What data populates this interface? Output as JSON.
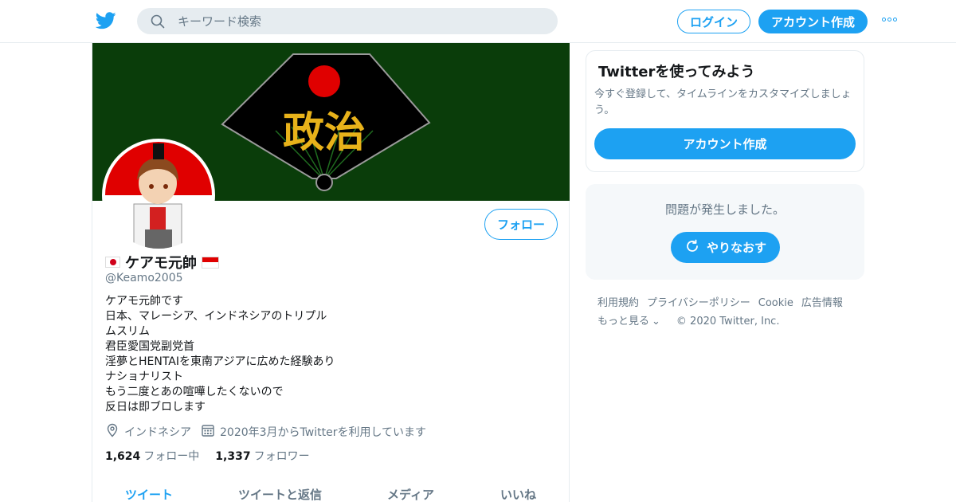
{
  "header": {
    "search_placeholder": "キーワード検索",
    "login_label": "ログイン",
    "signup_label": "アカウント作成"
  },
  "profile": {
    "banner_text": "政治",
    "name": "ケアモ元帥",
    "handle": "@Keamo2005",
    "bio_lines": [
      "ケアモ元帥です",
      "日本、マレーシア、インドネシアのトリプル",
      "ムスリム",
      "君臣愛国党副党首",
      "淫夢とHENTAIを東南アジアに広めた経験あり",
      "ナショナリスト",
      "もう二度とあの喧嘩したくないので",
      "反日は即ブロします"
    ],
    "follow_label": "フォロー",
    "location": "インドネシア",
    "joined": "2020年3月からTwitterを利用しています",
    "following_count": "1,624",
    "following_label": "フォロー中",
    "followers_count": "1,337",
    "followers_label": "フォロワー",
    "tabs": [
      "ツイート",
      "ツイートと返信",
      "メディア",
      "いいね"
    ]
  },
  "sidebar": {
    "try_title": "Twitterを使ってみよう",
    "try_desc": "今すぐ登録して、タイムラインをカスタマイズしましょう。",
    "try_button": "アカウント作成",
    "error_message": "問題が発生しました。",
    "retry_label": "やりなおす"
  },
  "footer": {
    "links": [
      "利用規約",
      "プライバシーポリシー",
      "Cookie",
      "広告情報"
    ],
    "more_label": "もっと見る",
    "copyright": "© 2020 Twitter, Inc."
  },
  "colors": {
    "accent": "#1da1f2",
    "banner_bg": "#0a3d0a",
    "text_secondary": "#657786"
  }
}
